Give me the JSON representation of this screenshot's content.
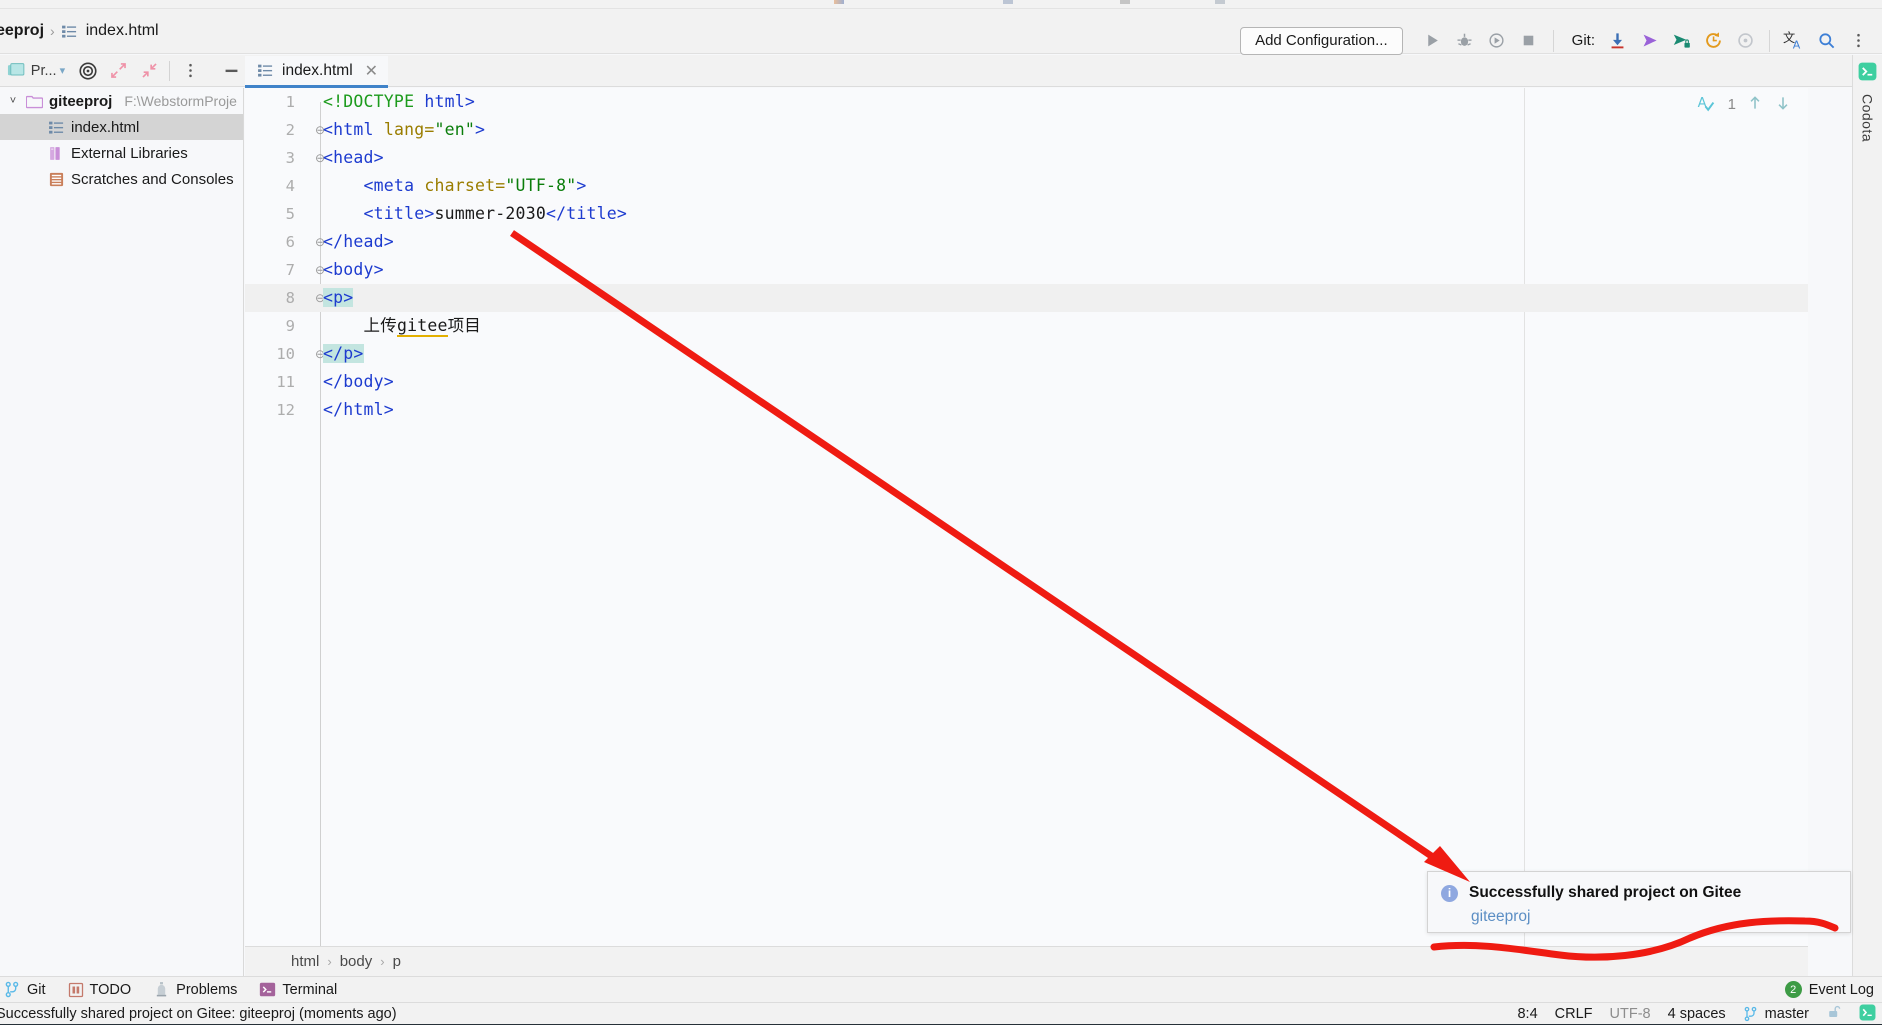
{
  "window": {
    "nav": {
      "project": "eeproj",
      "separator": "›",
      "file": "index.html",
      "file_icon": "html-file-icon"
    },
    "toolbar": {
      "add_configuration": "Add Configuration...",
      "run_icon": "run-icon",
      "debug_icon": "debug-icon",
      "run_coverage_icon": "run-with-coverage-icon",
      "stop_icon": "stop-icon",
      "git_label": "Git:",
      "update_icon": "update-project-icon",
      "push_icon": "push-commits-icon",
      "commit_icon": "commit-icon",
      "history_icon": "history-icon",
      "rollback_icon": "rollback-icon",
      "translate_icon": "translate-icon",
      "search_icon": "search-everywhere-icon",
      "more_icon": "kebab-menu-icon"
    }
  },
  "toolwindow_header": {
    "project_label": "Pr...",
    "chevron_icon": "chevron-down-icon",
    "locate_icon": "select-opened-file-icon",
    "expand_icon": "expand-all-icon",
    "collapse_icon": "collapse-all-icon",
    "options_icon": "options-kebab-icon",
    "hide_icon": "hide-window-icon",
    "tab_kebab_icon": "editor-tabs-kebab-icon"
  },
  "editor_tab": {
    "label": "index.html",
    "icon": "html-file-icon",
    "close_icon": "close-icon",
    "accent_color": "#4083c9"
  },
  "project_tree": [
    {
      "arrow": "˅",
      "icon": "folder-icon",
      "label": "giteeproj",
      "bold": true,
      "path": "F:\\WebstormProje",
      "selected": false,
      "indent": 0
    },
    {
      "arrow": "",
      "icon": "html-file-icon",
      "label": "index.html",
      "bold": false,
      "path": "",
      "selected": true,
      "indent": 1
    },
    {
      "arrow": "",
      "icon": "library-icon",
      "label": "External Libraries",
      "bold": false,
      "path": "",
      "selected": false,
      "indent": 1
    },
    {
      "arrow": "",
      "icon": "scratches-icon",
      "label": "Scratches and Consoles",
      "bold": false,
      "path": "",
      "selected": false,
      "indent": 1
    }
  ],
  "code": {
    "language": "HTML",
    "current_line": 8,
    "lines": [
      {
        "n": 1,
        "fold": "",
        "tokens": [
          {
            "t": "<!DOCTYPE ",
            "c": "tk-doc"
          },
          {
            "t": "html>",
            "c": "tk-br"
          }
        ]
      },
      {
        "n": 2,
        "fold": "⊖",
        "tokens": [
          {
            "t": "<html ",
            "c": "tk-br"
          },
          {
            "t": "lang=",
            "c": "tk-attr"
          },
          {
            "t": "\"en\"",
            "c": "tk-val"
          },
          {
            "t": ">",
            "c": "tk-br"
          }
        ]
      },
      {
        "n": 3,
        "fold": "⊖",
        "tokens": [
          {
            "t": "<head>",
            "c": "tk-br"
          }
        ]
      },
      {
        "n": 4,
        "fold": "",
        "tokens": [
          {
            "t": "    <meta ",
            "c": "tk-br"
          },
          {
            "t": "charset=",
            "c": "tk-attr"
          },
          {
            "t": "\"UTF-8\"",
            "c": "tk-val"
          },
          {
            "t": ">",
            "c": "tk-br"
          }
        ]
      },
      {
        "n": 5,
        "fold": "",
        "tokens": [
          {
            "t": "    <title>",
            "c": "tk-br"
          },
          {
            "t": "summer-2030",
            "c": "tk-txt"
          },
          {
            "t": "</title>",
            "c": "tk-br"
          }
        ]
      },
      {
        "n": 6,
        "fold": "⊖",
        "tokens": [
          {
            "t": "</head>",
            "c": "tk-br"
          }
        ]
      },
      {
        "n": 7,
        "fold": "⊖",
        "tokens": [
          {
            "t": "<body>",
            "c": "tk-br"
          }
        ]
      },
      {
        "n": 8,
        "fold": "⊖",
        "tokens": [
          {
            "t": "<p>",
            "c": "tk-br hl"
          }
        ]
      },
      {
        "n": 9,
        "fold": "",
        "tokens": [
          {
            "t": "    上传",
            "c": "tk-txt"
          },
          {
            "t": "gitee",
            "c": "tk-txt sp"
          },
          {
            "t": "项目",
            "c": "tk-txt"
          }
        ]
      },
      {
        "n": 10,
        "fold": "⊖",
        "tokens": [
          {
            "t": "</p>",
            "c": "tk-br hl"
          }
        ]
      },
      {
        "n": 11,
        "fold": "",
        "tokens": [
          {
            "t": "</body>",
            "c": "tk-br"
          }
        ]
      },
      {
        "n": 12,
        "fold": "",
        "tokens": [
          {
            "t": "</html>",
            "c": "tk-br"
          }
        ]
      }
    ]
  },
  "inspections": {
    "icon": "inspection-widget-icon",
    "count": "1",
    "prev_icon": "arrow-up-icon",
    "next_icon": "arrow-down-icon"
  },
  "right_rail": {
    "terminal_icon": "terminal-icon",
    "label": "Codota"
  },
  "editor_breadcrumb": {
    "items": [
      "html",
      "body",
      "p"
    ],
    "separator": "›"
  },
  "bottom_toolbar": {
    "items": [
      {
        "icon": "git-branch-icon",
        "label": "Git"
      },
      {
        "icon": "todo-icon",
        "label": "TODO"
      },
      {
        "icon": "problems-icon",
        "label": "Problems"
      },
      {
        "icon": "terminal-icon",
        "label": "Terminal"
      }
    ],
    "event_log": {
      "badge": "2",
      "label": "Event Log"
    }
  },
  "status_bar": {
    "message": "Successfully shared project on Gitee: giteeproj (moments ago)",
    "caret": "8:4",
    "line_separator": "CRLF",
    "encoding": "UTF-8",
    "indent": "4 spaces",
    "branch_icon": "git-branch-icon",
    "branch": "master",
    "lock_icon": "unlocked-icon",
    "terminal_icon": "terminal-icon"
  },
  "notification": {
    "info_icon": "info-icon",
    "title": "Successfully shared project on Gitee",
    "link": "giteeproj"
  },
  "annotations": {
    "arrow_color": "#ef1b12",
    "underline_color": "#ef1b12"
  }
}
